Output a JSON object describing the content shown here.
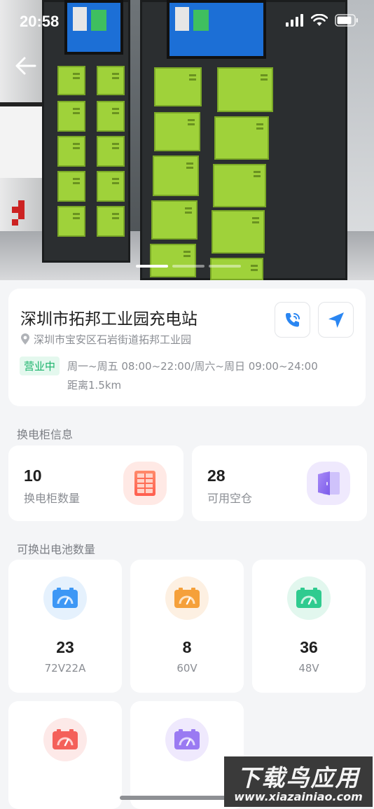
{
  "status_bar": {
    "time": "20:58"
  },
  "station": {
    "name": "深圳市拓邦工业园充电站",
    "address": "深圳市宝安区石岩街道拓邦工业园",
    "status": "营业中",
    "hours": "周一~周五 08:00~22:00/周六~周日 09:00~24:00",
    "distance": "距离1.5km",
    "call_icon": "phone-call-icon",
    "nav_icon": "navigation-arrow-icon"
  },
  "carousel": {
    "slide_count": 3,
    "active_index": 0
  },
  "cabinet_section": {
    "title": "换电柜信息",
    "cards": [
      {
        "value": "10",
        "label": "换电柜数量",
        "icon": "cabinet-icon",
        "icon_color": "#ff6f5b"
      },
      {
        "value": "28",
        "label": "可用空仓",
        "icon": "door-icon",
        "icon_color": "#8a6cf0"
      }
    ]
  },
  "battery_section": {
    "title": "可换出电池数量",
    "items": [
      {
        "count": "23",
        "spec": "72V22A",
        "icon": "battery-gauge-icon",
        "color": "#3d97f5",
        "bg": "#e5f1fd"
      },
      {
        "count": "8",
        "spec": "60V",
        "icon": "battery-gauge-icon",
        "color": "#f5a03a",
        "bg": "#fdf0e2"
      },
      {
        "count": "36",
        "spec": "48V",
        "icon": "battery-gauge-icon",
        "color": "#2fcb8f",
        "bg": "#e2f7ee"
      },
      {
        "count": "",
        "spec": "",
        "icon": "battery-gauge-icon",
        "color": "#f4605a",
        "bg": "#fde9e8"
      },
      {
        "count": "",
        "spec": "",
        "icon": "battery-gauge-icon",
        "color": "#9a7af2",
        "bg": "#efe9fd"
      }
    ]
  },
  "watermark": {
    "title": "下载鸟应用",
    "url": "www.xiazainiao.com"
  }
}
